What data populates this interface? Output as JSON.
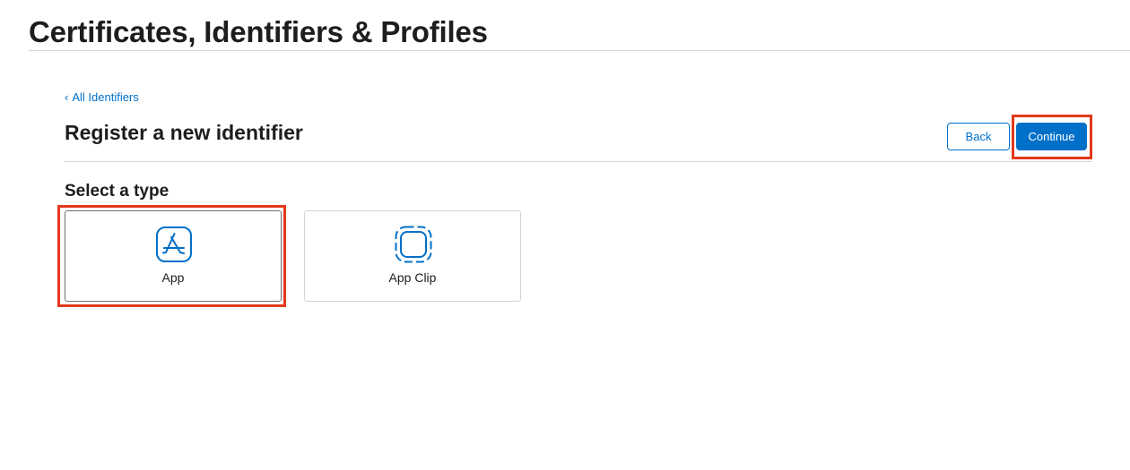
{
  "header": {
    "title": "Certificates, Identifiers & Profiles"
  },
  "breadcrumb": {
    "chevron": "‹",
    "label": "All Identifiers"
  },
  "form": {
    "heading": "Register a new identifier",
    "back_label": "Back",
    "continue_label": "Continue"
  },
  "type_selector": {
    "heading": "Select a type",
    "selected": "App",
    "options": [
      {
        "label": "App",
        "icon": "app-store-icon"
      },
      {
        "label": "App Clip",
        "icon": "app-clip-icon"
      }
    ]
  },
  "colors": {
    "accent": "#0070c9",
    "highlight": "#e2391b",
    "text": "#1d1d1f",
    "divider": "#d2d2d7"
  }
}
